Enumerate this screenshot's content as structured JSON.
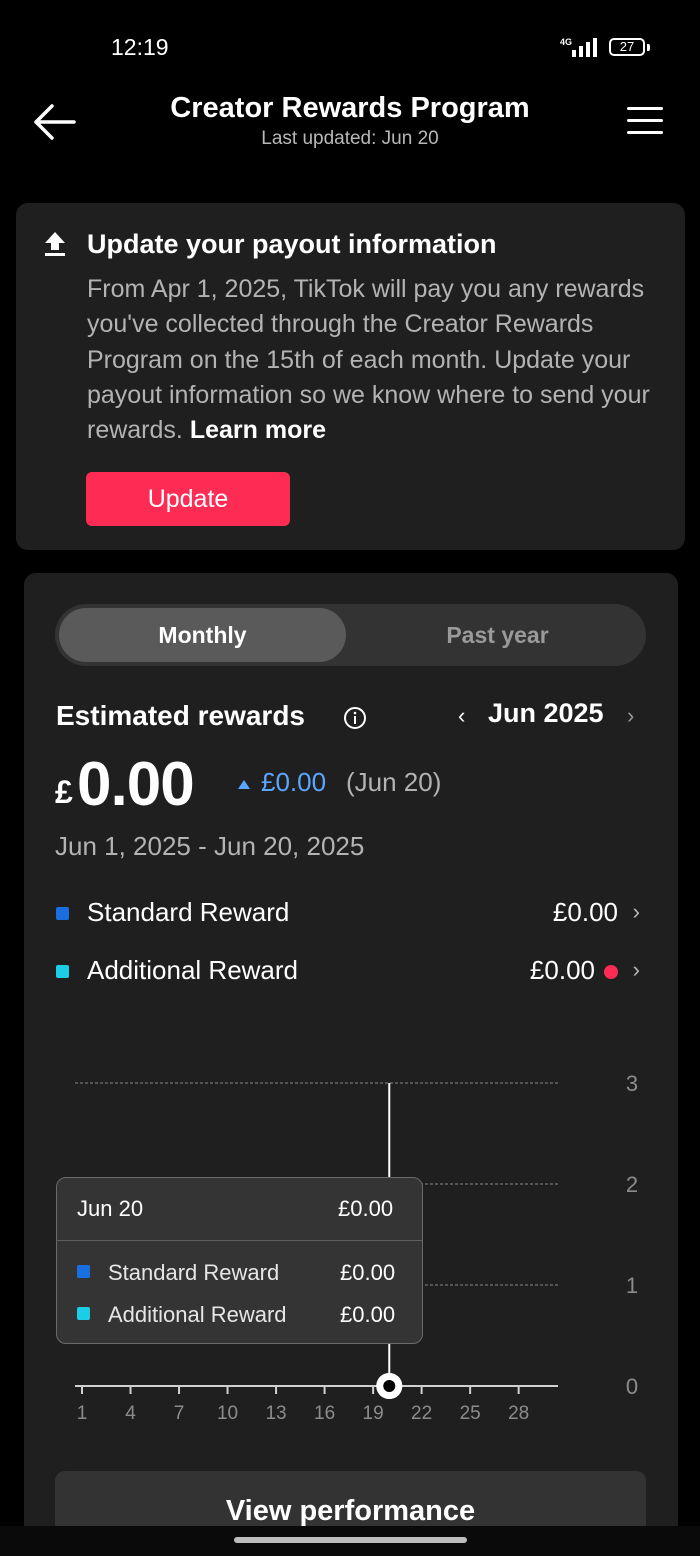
{
  "status_bar": {
    "time": "12:19",
    "network": "4G",
    "battery": "27"
  },
  "header": {
    "title": "Creator Rewards Program",
    "subtitle": "Last updated: Jun 20"
  },
  "payout_card": {
    "title": "Update your payout information",
    "body": "From Apr 1, 2025, TikTok will pay you any rewards you've collected through the Creator Rewards Program on the 15th of each month. Update your payout information so we know where to send your rewards.",
    "learn_more": "Learn more",
    "button": "Update"
  },
  "tabs": [
    {
      "label": "Monthly",
      "active": true
    },
    {
      "label": "Past year",
      "active": false
    }
  ],
  "rewards": {
    "title": "Estimated rewards",
    "month": "Jun 2025",
    "currency": "£",
    "amount": "0.00",
    "change": "£0.00",
    "change_date": "(Jun 20)",
    "date_range": "Jun 1, 2025 - Jun 20, 2025",
    "items": [
      {
        "label": "Standard Reward",
        "value": "£0.00",
        "color": "#1a6fe0",
        "alert": false
      },
      {
        "label": "Additional Reward",
        "value": "£0.00",
        "color": "#1ccde8",
        "alert": true
      }
    ]
  },
  "chart_data": {
    "type": "line",
    "x_ticks": [
      "1",
      "4",
      "7",
      "10",
      "13",
      "16",
      "19",
      "22",
      "25",
      "28"
    ],
    "y_ticks": [
      "0",
      "1",
      "2",
      "3"
    ],
    "ylim": [
      0,
      3
    ],
    "xlim": [
      1,
      30
    ],
    "series": [
      {
        "name": "Standard Reward",
        "color": "#1a6fe0",
        "x": [
          20
        ],
        "y": [
          0
        ]
      },
      {
        "name": "Additional Reward",
        "color": "#1ccde8",
        "x": [
          20
        ],
        "y": [
          0
        ]
      }
    ],
    "selected_x": 20,
    "tooltip": {
      "date": "Jun 20",
      "total": "£0.00",
      "rows": [
        {
          "label": "Standard Reward",
          "value": "£0.00",
          "color": "#1a6fe0"
        },
        {
          "label": "Additional Reward",
          "value": "£0.00",
          "color": "#1ccde8"
        }
      ]
    }
  },
  "footer": {
    "button": "View performance"
  }
}
